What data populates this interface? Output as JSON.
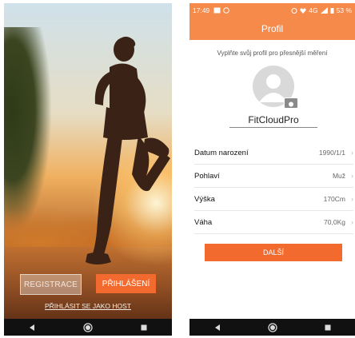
{
  "left_screen": {
    "buttons": {
      "register": "REGISTRACE",
      "login": "PŘIHLÁŠENÍ"
    },
    "guest_link": "PŘIHLÁSIT SE JAKO HOST"
  },
  "right_screen": {
    "status_bar": {
      "time": "17:49",
      "network": "4G",
      "battery": "53 %"
    },
    "title": "Profil",
    "hint": "Vyplňte svůj profil pro přesnější měření",
    "username": "FitCloudPro",
    "fields": [
      {
        "label": "Datum narození",
        "value": "1990/1/1"
      },
      {
        "label": "Pohlaví",
        "value": "Muž"
      },
      {
        "label": "Výška",
        "value": "170Cm"
      },
      {
        "label": "Váha",
        "value": "70,0Kg"
      }
    ],
    "next_button": "DALŠÍ"
  },
  "colors": {
    "accent": "#f26a2e",
    "header": "#f58a4a",
    "nav_bar": "#111111"
  },
  "icons": {
    "nav_back": "back-triangle-icon",
    "nav_home": "home-circle-icon",
    "nav_recent": "recent-square-icon"
  }
}
